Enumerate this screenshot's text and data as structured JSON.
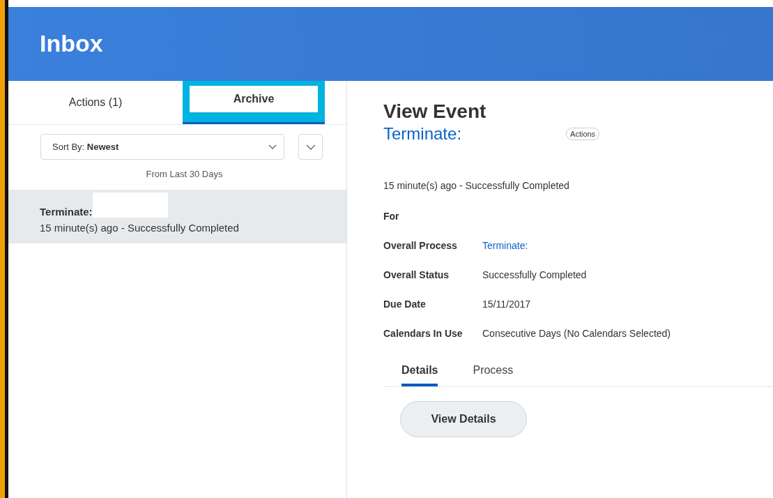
{
  "header": {
    "title": "Inbox"
  },
  "tabs": [
    {
      "label": "Actions (1)",
      "selected": false
    },
    {
      "label": "Archive",
      "selected": true
    }
  ],
  "sort": {
    "label": "Sort By:",
    "value": "Newest"
  },
  "range_note": "From Last 30 Days",
  "inbox_items": [
    {
      "title": "Terminate:",
      "subtitle": "15 minute(s) ago - Successfully Completed",
      "selected": true
    }
  ],
  "event": {
    "heading": "View Event",
    "title": "Terminate:",
    "actions_label": "Actions",
    "summary": "15 minute(s) ago - Successfully Completed",
    "fields": [
      {
        "label": "For"
      },
      {
        "label": "Overall Process",
        "value": "Terminate:",
        "kind": "link"
      },
      {
        "label": "Overall Status",
        "value": "Successfully Completed",
        "kind": "text"
      },
      {
        "label": "Due Date",
        "value": "15/11/2017",
        "kind": "text"
      },
      {
        "label": "Calendars In Use",
        "value": "Consecutive Days (No Calendars Selected)",
        "kind": "text"
      }
    ],
    "tabs": [
      {
        "label": "Details",
        "selected": true
      },
      {
        "label": "Process",
        "selected": false
      }
    ],
    "button": "View Details"
  }
}
